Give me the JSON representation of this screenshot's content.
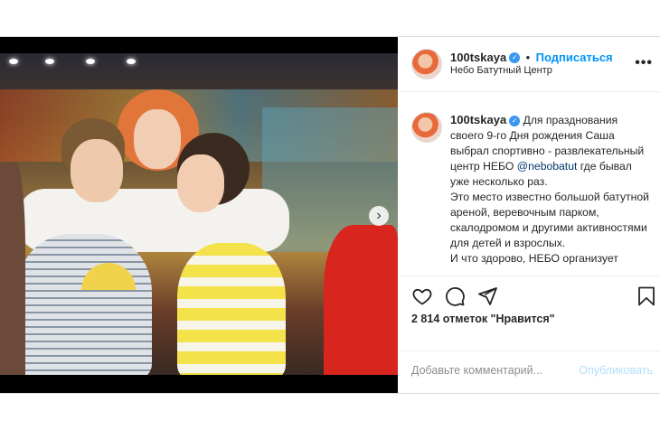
{
  "post": {
    "username": "100tskaya",
    "follow_label": "Подписаться",
    "location": "Небо Батутный Центр",
    "more_label": "•••",
    "caption_username": "100tskaya",
    "caption_part1": "Для празднования своего 9-го Дня рождения Саша выбрал спортивно - развлекательный центр НЕБО",
    "caption_mention": "@nebobatut",
    "caption_part2": "где бывал уже несколько раз.",
    "caption_part3": "Это место известно большой батутной ареной, веревочным парком, скалодромом и другими активностями для детей и взрослых.",
    "caption_part4": "И что здорово, НЕБО организует",
    "likes": "2 814 отметок \"Нравится\"",
    "comment_placeholder": "Добавьте комментарий...",
    "publish_label": "Опубликовать",
    "next_label": "›"
  },
  "icons": [
    "verified-badge-icon",
    "heart-icon",
    "comment-icon",
    "share-icon",
    "bookmark-icon",
    "chevron-right-icon"
  ],
  "colors": {
    "accent": "#0095f6",
    "verified": "#3897f0",
    "publish_disabled": "#b2dffc"
  }
}
